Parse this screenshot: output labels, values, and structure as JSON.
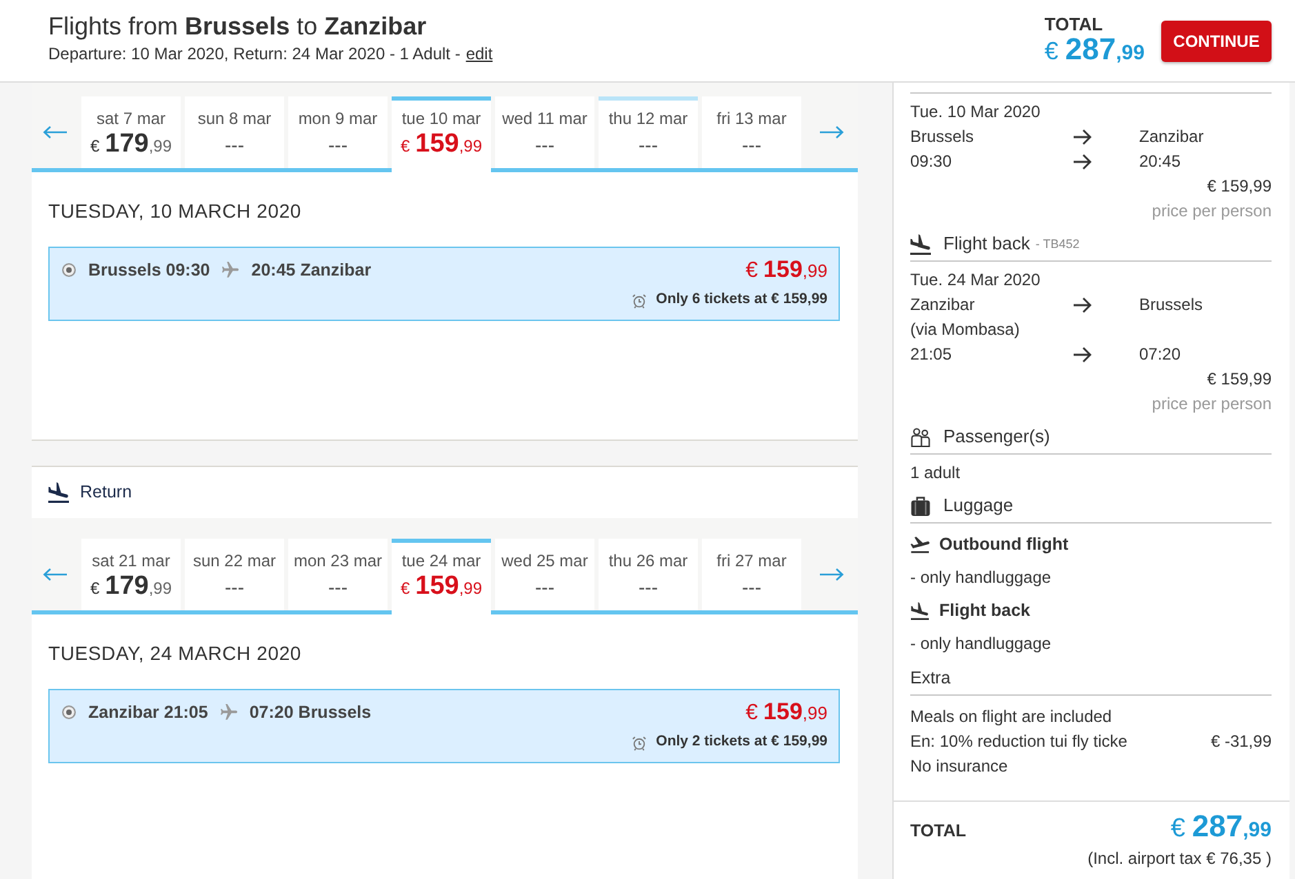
{
  "header": {
    "title": "Flights from **Brussels** to **Zanzibar**",
    "subtitle": "Departure: 10 Mar 2020, Return: 24 Mar 2020 - 1 Adult -",
    "edit_link": "edit",
    "total_label": "TOTAL",
    "total_price": "€ 287,99",
    "continue_button": "CONTINUE"
  },
  "outbound": {
    "days": [
      {
        "label": "sat 7 mar",
        "price": "€ 179,99",
        "selected": false,
        "hovered": false
      },
      {
        "label": "sun 8 mar",
        "price": "---",
        "selected": false,
        "hovered": false
      },
      {
        "label": "mon 9 mar",
        "price": "---",
        "selected": false,
        "hovered": false
      },
      {
        "label": "tue 10 mar",
        "price": "€ 159,99",
        "selected": true,
        "hovered": false
      },
      {
        "label": "wed 11 mar",
        "price": "---",
        "selected": false,
        "hovered": false
      },
      {
        "label": "thu 12 mar",
        "price": "---",
        "selected": false,
        "hovered": true
      },
      {
        "label": "fri 13 mar",
        "price": "---",
        "selected": false,
        "hovered": false
      }
    ],
    "date_heading": "TUESDAY, 10 MARCH 2020",
    "options": [
      {
        "selected": true,
        "departure": "Brussels 09:30",
        "arrival": "20:45 Zanzibar",
        "price": "€ 159,99",
        "notice": "Only 6 tickets at € 159,99"
      }
    ]
  },
  "return": {
    "heading": "Return",
    "days": [
      {
        "label": "sat 21 mar",
        "price": "€ 179,99",
        "selected": false,
        "hovered": false
      },
      {
        "label": "sun 22 mar",
        "price": "---",
        "selected": false,
        "hovered": false
      },
      {
        "label": "mon 23 mar",
        "price": "---",
        "selected": false,
        "hovered": false
      },
      {
        "label": "tue 24 mar",
        "price": "€ 159,99",
        "selected": true,
        "hovered": false
      },
      {
        "label": "wed 25 mar",
        "price": "---",
        "selected": false,
        "hovered": false
      },
      {
        "label": "thu 26 mar",
        "price": "---",
        "selected": false,
        "hovered": false
      },
      {
        "label": "fri 27 mar",
        "price": "---",
        "selected": false,
        "hovered": false
      }
    ],
    "date_heading": "TUESDAY, 24 MARCH 2020",
    "options": [
      {
        "selected": true,
        "departure": "Zanzibar 21:05",
        "arrival": "07:20 Brussels",
        "price": "€ 159,99",
        "notice": "Only 2 tickets at € 159,99"
      }
    ]
  },
  "summary": {
    "outbound": {
      "date": "Tue. 10 Mar 2020",
      "legs": [
        {
          "from": "Brussels",
          "to": "Zanzibar"
        },
        {
          "from": "09:30",
          "to": "20:45"
        }
      ],
      "price": "€ 159,99",
      "price_note": "price per person"
    },
    "flight_back": {
      "title": "Flight back",
      "code": "- TB452",
      "date": "Tue. 24 Mar 2020",
      "legs": [
        {
          "from": "Zanzibar",
          "to": "Brussels"
        },
        {
          "from": "(via Mombasa)"
        },
        {
          "from": "21:05",
          "to": "07:20"
        }
      ],
      "price": "€ 159,99",
      "price_note": "price per person"
    },
    "passengers": {
      "title": "Passenger(s)",
      "items": [
        "1 adult"
      ]
    },
    "luggage": {
      "title": "Luggage",
      "groups": [
        {
          "kind": "outbound",
          "title": "Outbound flight",
          "items": [
            "- only handluggage"
          ]
        },
        {
          "kind": "return",
          "title": "Flight back",
          "items": [
            "- only handluggage"
          ]
        }
      ]
    },
    "extra": {
      "title": "Extra",
      "items": [
        {
          "label": "Meals on flight are included"
        },
        {
          "label": "En: 10% reduction tui fly ticke",
          "amount": "€ -31,99"
        },
        {
          "label": "No insurance"
        }
      ]
    },
    "total": {
      "label": "TOTAL",
      "price": "€ 287,99",
      "note": "(Incl. airport tax € 76,35 )"
    }
  }
}
